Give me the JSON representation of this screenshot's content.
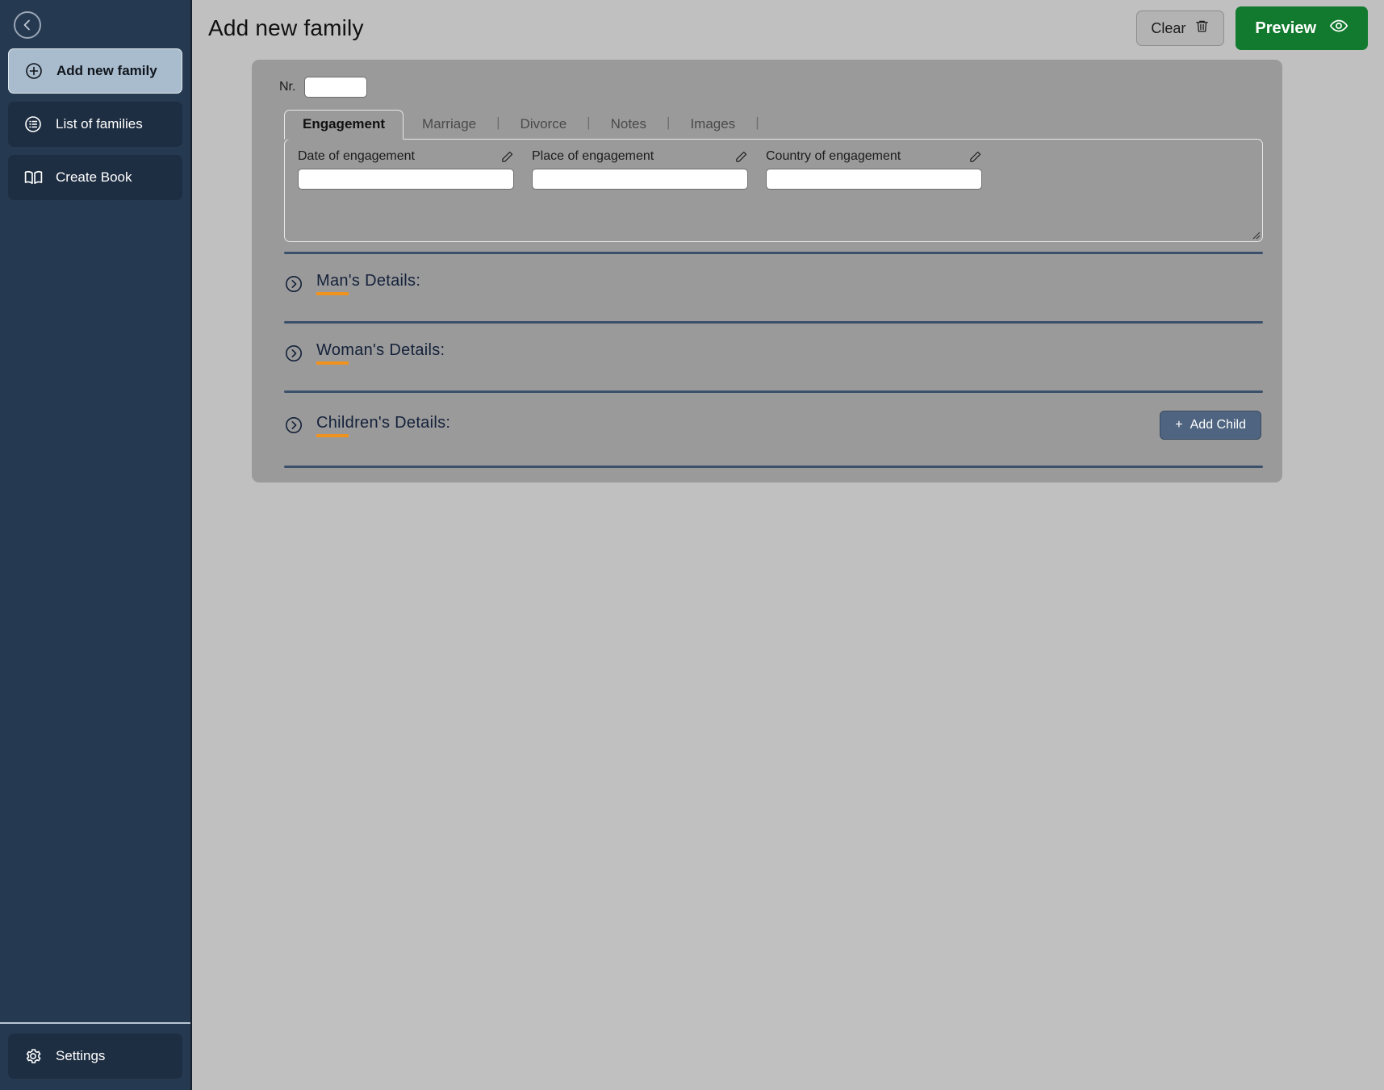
{
  "sidebar": {
    "collapse_icon": "chevron-left-circle-icon",
    "items": [
      {
        "label": "Add new family",
        "icon": "plus-circle-icon",
        "active": true
      },
      {
        "label": "List of families",
        "icon": "list-circle-icon",
        "active": false
      },
      {
        "label": "Create Book",
        "icon": "book-open-icon",
        "active": false
      }
    ],
    "footer": {
      "label": "Settings",
      "icon": "gear-icon"
    }
  },
  "header": {
    "title": "Add new family",
    "clear_label": "Clear",
    "clear_icon": "trash-icon",
    "preview_label": "Preview",
    "preview_icon": "eye-icon"
  },
  "form": {
    "nr_label": "Nr.",
    "nr_value": "",
    "nr_placeholder": "",
    "tabs": [
      {
        "label": "Engagement",
        "active": true
      },
      {
        "label": "Marriage",
        "active": false
      },
      {
        "label": "Divorce",
        "active": false
      },
      {
        "label": "Notes",
        "active": false
      },
      {
        "label": "Images",
        "active": false
      }
    ],
    "tab_separator": "|",
    "fields": [
      {
        "label": "Date of engagement",
        "value": "",
        "placeholder": "",
        "edit_icon": "pencil-icon"
      },
      {
        "label": "Place of engagement",
        "value": "",
        "placeholder": "",
        "edit_icon": "pencil-icon"
      },
      {
        "label": "Country of engagement",
        "value": "",
        "placeholder": "",
        "edit_icon": "pencil-icon"
      }
    ]
  },
  "sections": [
    {
      "title": "Man's Details:",
      "icon": "chevron-right-circle-icon",
      "expanded": false
    },
    {
      "title": "Woman's Details:",
      "icon": "chevron-right-circle-icon",
      "expanded": false
    },
    {
      "title": "Children's Details:",
      "icon": "chevron-right-circle-icon",
      "expanded": false
    }
  ],
  "children_section": {
    "add_child_label": "Add Child",
    "add_child_prefix": "+"
  },
  "colors": {
    "sidebar_bg": "#253951",
    "sidebar_active": "#a9bccd",
    "page_bg": "#c0c0c0",
    "card_bg": "#9a9a9a",
    "accent_orange": "#f0921e",
    "preview_green": "#127a2e",
    "divider_navy": "#3b506b",
    "add_child_bg": "#4e6480"
  }
}
